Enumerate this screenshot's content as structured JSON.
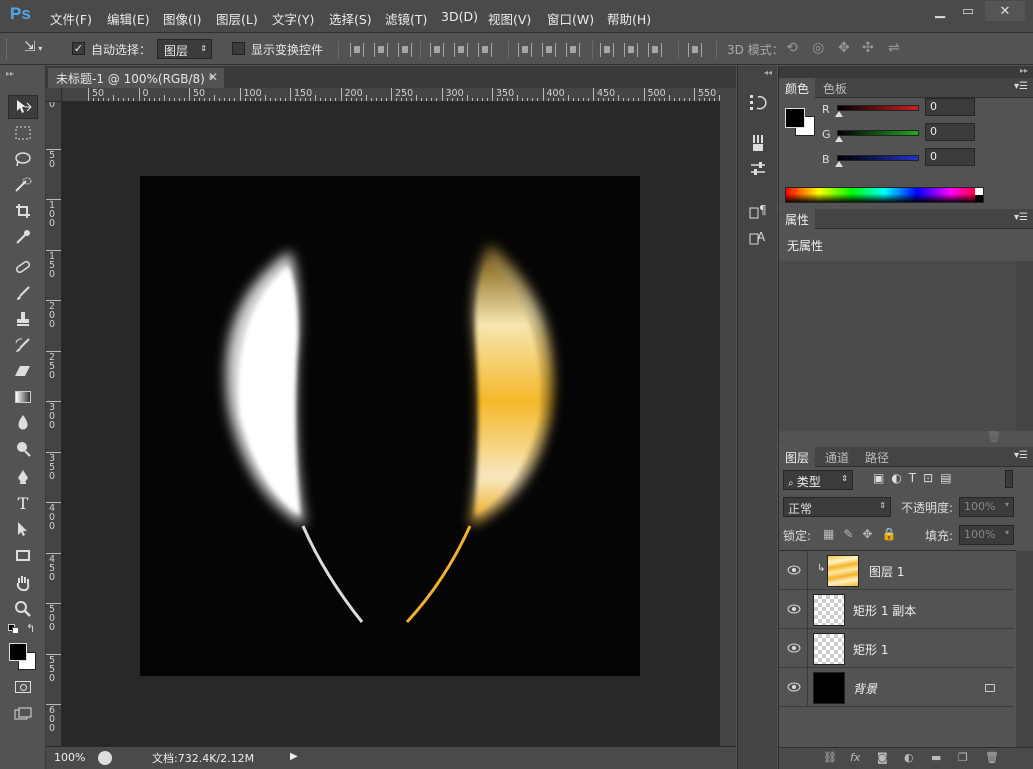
{
  "app": {
    "logo": "Ps"
  },
  "menu": [
    "文件(F)",
    "编辑(E)",
    "图像(I)",
    "图层(L)",
    "文字(Y)",
    "选择(S)",
    "滤镜(T)",
    "3D(D)",
    "视图(V)",
    "窗口(W)",
    "帮助(H)"
  ],
  "options": {
    "auto_select_label": "自动选择：",
    "auto_select_checked": true,
    "auto_select_target": "图层",
    "show_transform_label": "显示变换控件",
    "mode_3d_label": "3D 模式："
  },
  "document": {
    "tab_title": "未标题-1 @ 100%(RGB/8) *",
    "ruler_h": [
      "50",
      "0",
      "50",
      "100",
      "150",
      "200",
      "250",
      "300",
      "350",
      "400",
      "450",
      "500",
      "550"
    ],
    "ruler_v": [
      "0",
      "5\n0",
      "1\n0\n0",
      "1\n5\n0",
      "2\n0\n0",
      "2\n5\n0",
      "3\n0\n0",
      "3\n5\n0",
      "4\n0\n0",
      "4\n5\n0",
      "5\n0\n0",
      "5\n5\n0",
      "6\n0\n0"
    ]
  },
  "status": {
    "zoom": "100%",
    "doc_info": "文档:732.4K/2.12M"
  },
  "color_panel": {
    "tabs": [
      "颜色",
      "色板"
    ],
    "channels": [
      {
        "name": "R",
        "value": "0",
        "color": "#cc2222"
      },
      {
        "name": "G",
        "value": "0",
        "color": "#22aa22"
      },
      {
        "name": "B",
        "value": "0",
        "color": "#2233cc"
      }
    ]
  },
  "properties_panel": {
    "tab": "属性",
    "message": "无属性"
  },
  "layers_panel": {
    "tabs": [
      "图层",
      "通道",
      "路径"
    ],
    "filter_label": "类型",
    "blend_mode": "正常",
    "opacity_label": "不透明度:",
    "opacity_value": "100%",
    "lock_label": "锁定:",
    "fill_label": "填充:",
    "fill_value": "100%",
    "layers": [
      {
        "name": "图层 1",
        "thumb": "yellow",
        "clipped": true,
        "locked": false
      },
      {
        "name": "矩形 1 副本",
        "thumb": "checker",
        "clipped": false,
        "locked": false
      },
      {
        "name": "矩形 1",
        "thumb": "checker",
        "clipped": false,
        "locked": false
      },
      {
        "name": "背景",
        "thumb": "black",
        "clipped": false,
        "locked": true
      }
    ],
    "footer_icons": [
      "link-icon",
      "fx-icon",
      "mask-icon",
      "adjustment-icon",
      "group-icon",
      "new-layer-icon",
      "trash-icon"
    ]
  },
  "colors": {
    "accent": "#4fa8ef",
    "foreground": "#000000",
    "background": "#ffffff"
  }
}
